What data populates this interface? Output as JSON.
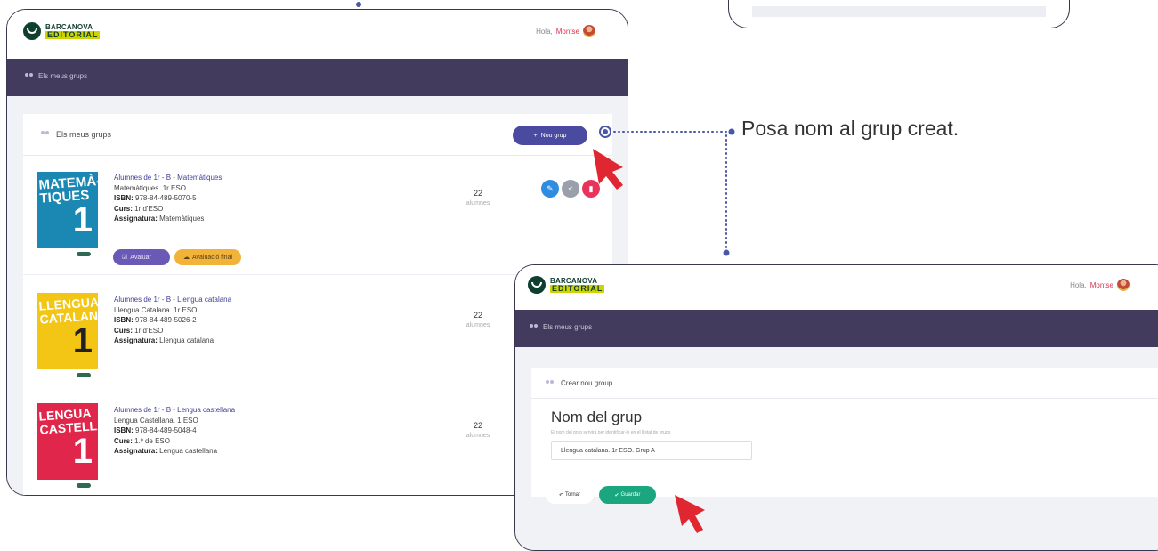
{
  "app": {
    "logo_line1": "BARCANOVA",
    "logo_line2": "EDITORIAL",
    "greeting_prefix": "Hola,",
    "user_name": "Montse",
    "nav_item": "Els meus grups"
  },
  "groups_page": {
    "card_title": "Els meus grups",
    "new_group_label": "Nou grup",
    "groups": [
      {
        "title": "Alumnes de 1r - B - Matemàtiques",
        "subject_line": "Matemàtiques. 1r ESO",
        "isbn_label": "ISBN:",
        "isbn": "978-84-489-5070-5",
        "course_label": "Curs:",
        "course": "1r d'ESO",
        "subject_label": "Assignatura:",
        "subject": "Matemàtiques",
        "students": "22",
        "students_unit": "alumnes",
        "cover_title": "MATEMÀ-TIQUES",
        "cover_num": "1",
        "cover_color": "#1b88b4"
      },
      {
        "title": "Alumnes de 1r - B - Llengua catalana",
        "subject_line": "Llengua Catalana. 1r ESO",
        "isbn_label": "ISBN:",
        "isbn": "978-84-489-5026-2",
        "course_label": "Curs:",
        "course": "1r d'ESO",
        "subject_label": "Assignatura:",
        "subject": "Llengua catalana",
        "students": "22",
        "students_unit": "alumnes",
        "cover_title": "LLENGUA CATALANA",
        "cover_num": "1",
        "cover_color": "#f3c515"
      },
      {
        "title": "Alumnes de 1r - B - Lengua castellana",
        "subject_line": "Lengua Castellana. 1 ESO",
        "isbn_label": "ISBN:",
        "isbn": "978-84-489-5048-4",
        "course_label": "Curs:",
        "course": "1.º de ESO",
        "subject_label": "Assignatura:",
        "subject": "Lengua castellana",
        "students": "22",
        "students_unit": "alumnes",
        "cover_title": "LENGUA CASTELLANA",
        "cover_num": "1",
        "cover_color": "#e0264b"
      }
    ],
    "evaluate_label": "Avaluar",
    "final_eval_label": "Avaluació final",
    "action_colors": {
      "edit": "#2f8de0",
      "share": "#9aa0ab",
      "delete": "#e8345a"
    }
  },
  "new_group_page": {
    "card_title": "Crear nou group",
    "heading": "Nom del grup",
    "help_text": "El nom del grup servirà per identificar-lo en el llistat de grups",
    "input_value": "Llengua catalana. 1r ESO. Grup A",
    "back_label": "Tornar",
    "save_label": "Guardar"
  },
  "callout": {
    "text": "Posa nom al grup creat."
  },
  "colors": {
    "navbar": "#433b5e",
    "accent": "#4a4ba0",
    "connector": "#4a57a6",
    "arrow": "#e02731"
  }
}
